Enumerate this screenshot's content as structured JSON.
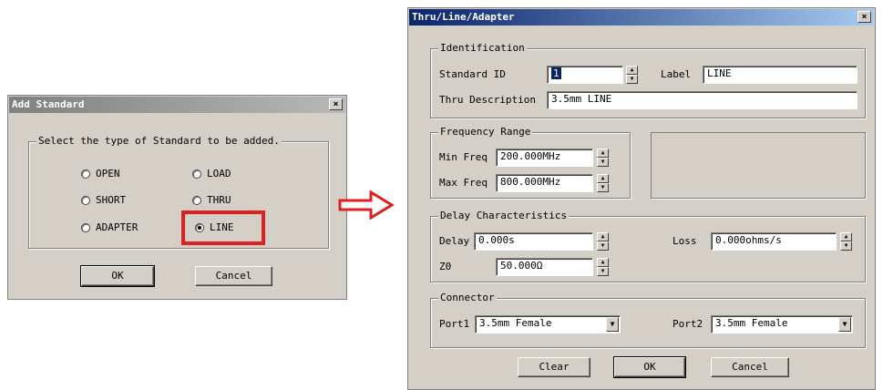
{
  "add_dialog": {
    "title": "Add Standard",
    "close_label": "×",
    "group_title": "Select the type of Standard to be added.",
    "options": [
      {
        "label": "OPEN",
        "selected": false
      },
      {
        "label": "LOAD",
        "selected": false
      },
      {
        "label": "SHORT",
        "selected": false
      },
      {
        "label": "THRU",
        "selected": false
      },
      {
        "label": "ADAPTER",
        "selected": false
      },
      {
        "label": "LINE",
        "selected": true
      }
    ],
    "ok_label": "OK",
    "cancel_label": "Cancel",
    "highlight_color": "#e02020"
  },
  "arrow": {
    "color": "#e02020"
  },
  "tla_dialog": {
    "title": "Thru/Line/Adapter",
    "close_label": "×",
    "identification": {
      "group_title": "Identification",
      "standard_id_label": "Standard ID",
      "standard_id_value": "1",
      "label_label": "Label",
      "label_value": "LINE",
      "thru_description_label": "Thru Description",
      "thru_description_value": "3.5mm LINE"
    },
    "frequency": {
      "group_title": "Frequency Range",
      "min_label": "Min Freq",
      "min_value": "200.000MHz",
      "max_label": "Max Freq",
      "max_value": "800.000MHz"
    },
    "delay": {
      "group_title": "Delay Characteristics",
      "delay_label": "Delay",
      "delay_value": "0.000s",
      "loss_label": "Loss",
      "loss_value": "0.000ohms/s",
      "z0_label": "Z0",
      "z0_value": "50.000Ω"
    },
    "connector": {
      "group_title": "Connector",
      "port1_label": "Port1",
      "port1_value": "3.5mm Female",
      "port2_label": "Port2",
      "port2_value": "3.5mm Female"
    },
    "clear_label": "Clear",
    "ok_label": "OK",
    "cancel_label": "Cancel"
  }
}
